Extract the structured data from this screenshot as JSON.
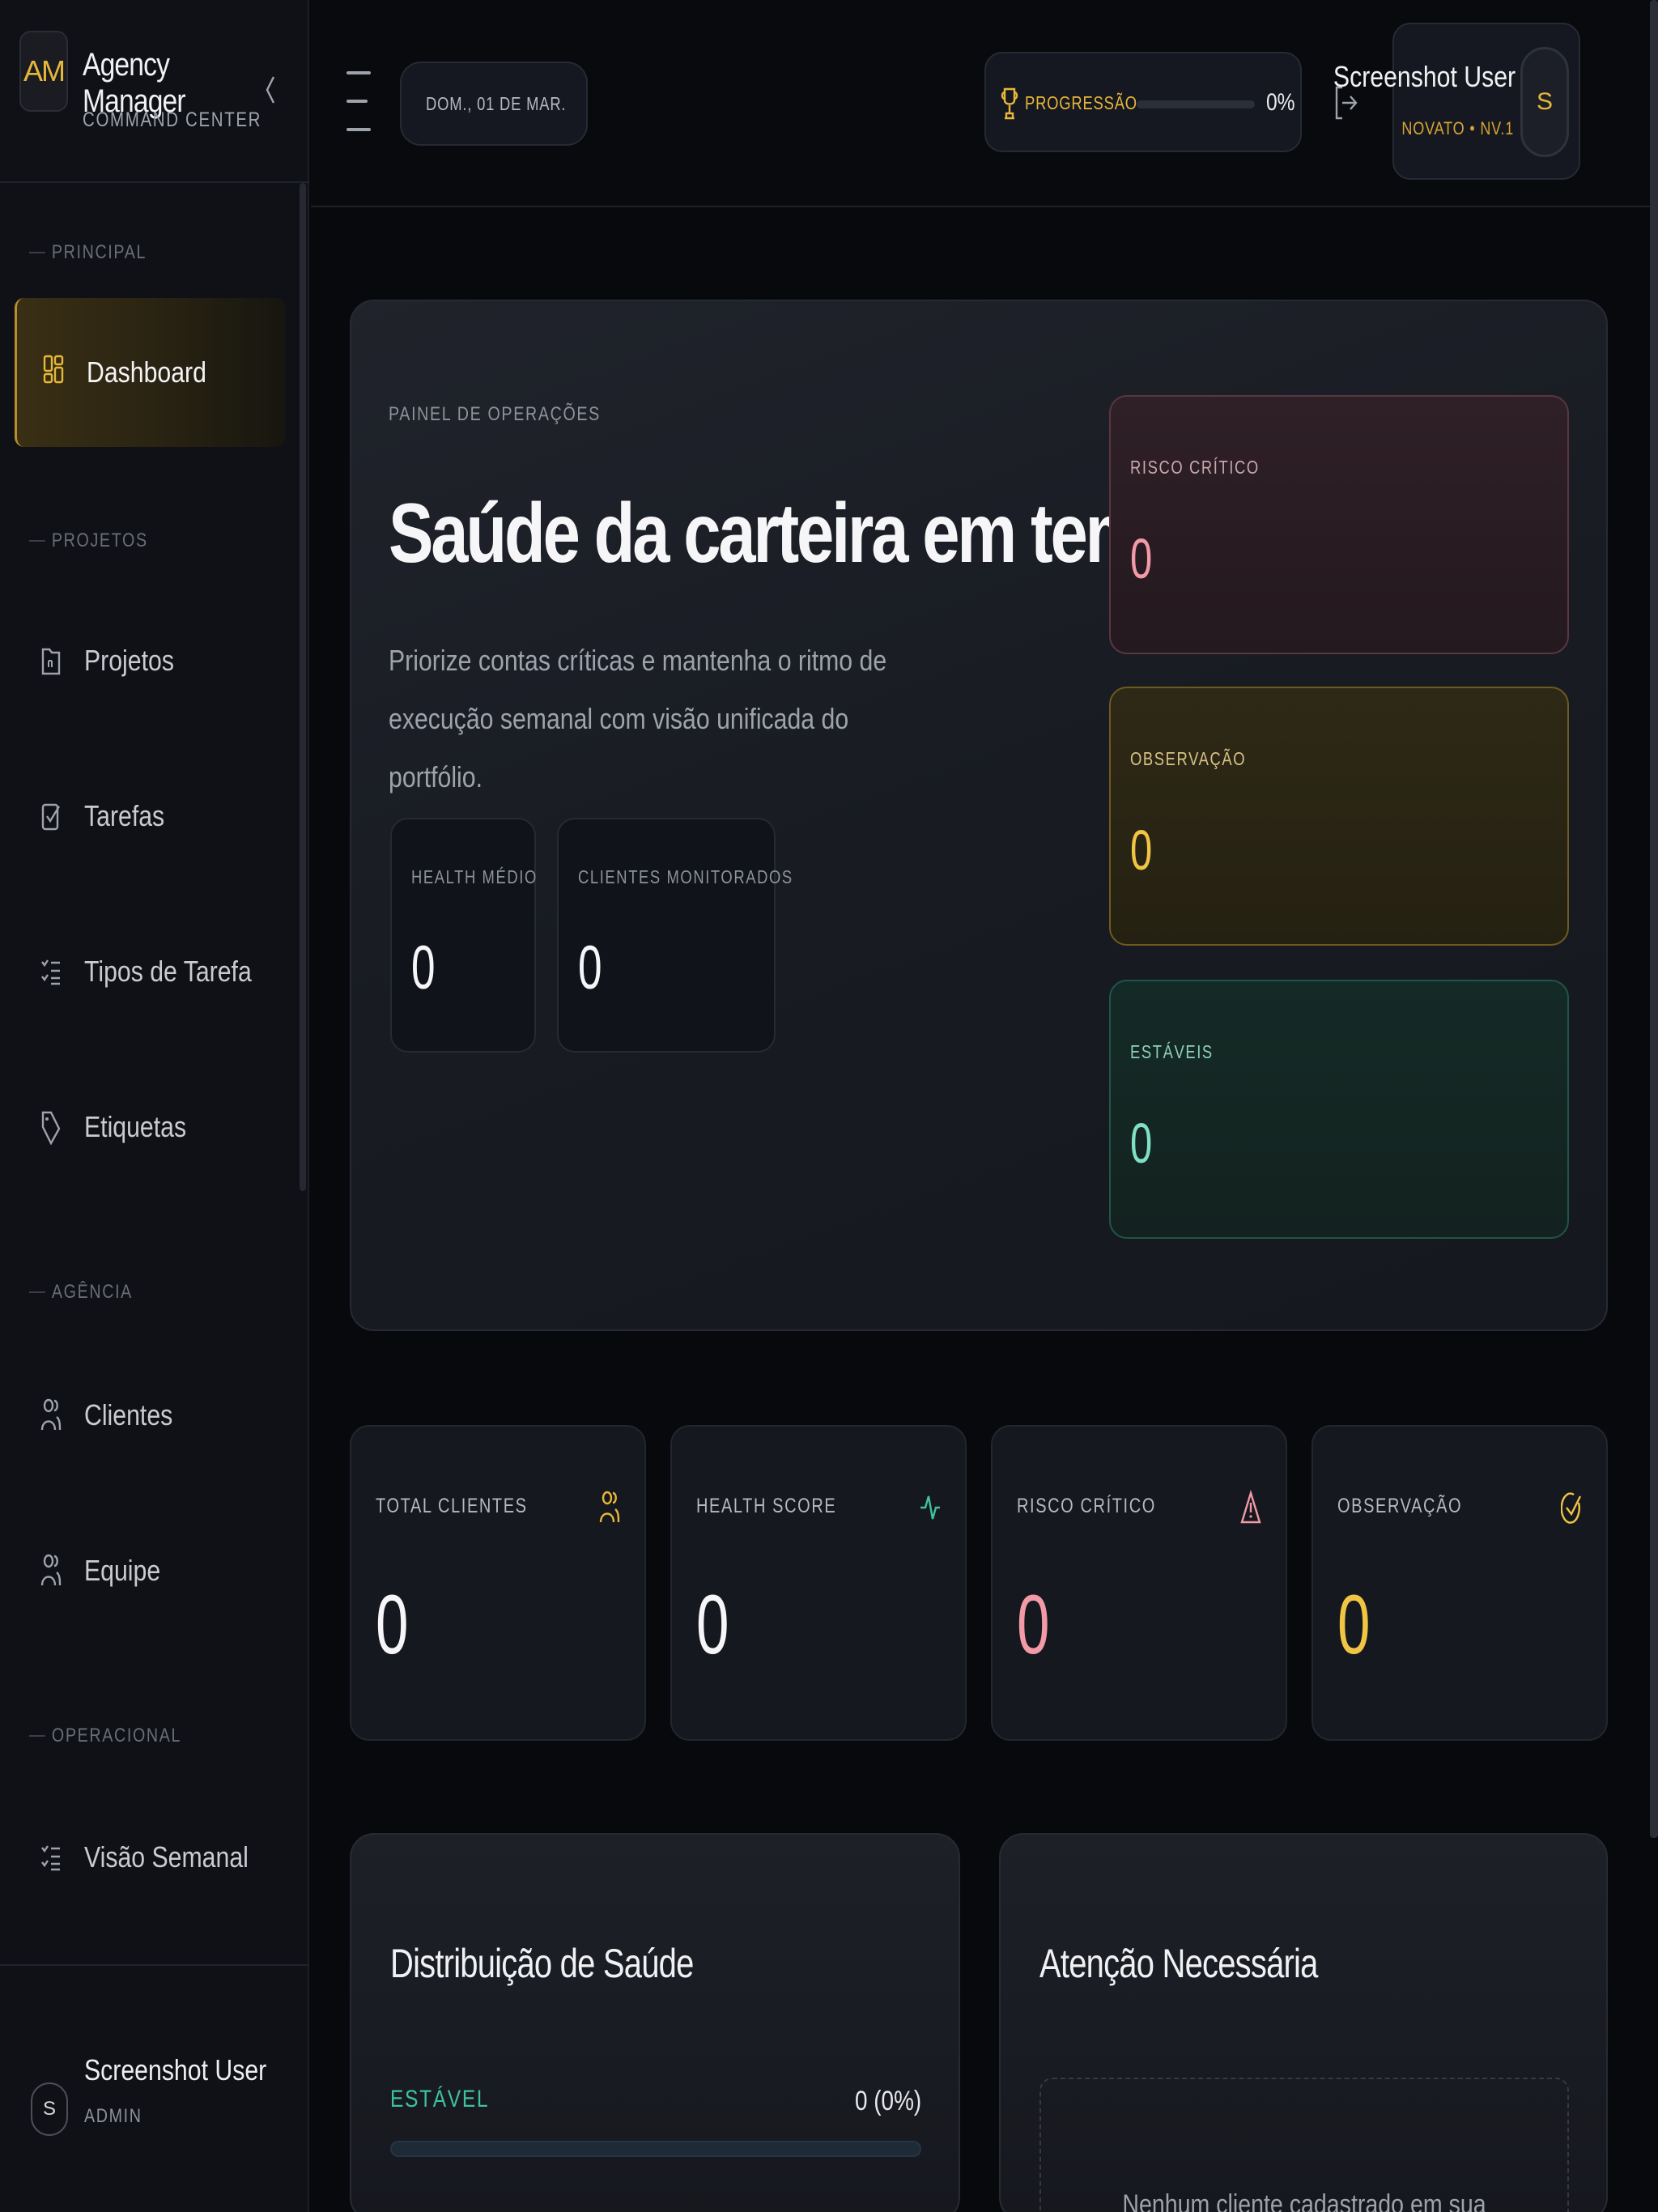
{
  "brand": {
    "logo": "AM",
    "title": "Agency Manager",
    "subtitle": "COMMAND CENTER"
  },
  "sidebar": {
    "sections": [
      "PRINCIPAL",
      "PROJETOS",
      "AGÊNCIA",
      "OPERACIONAL"
    ],
    "items": [
      {
        "label": "Dashboard",
        "icon": "dashboard-icon",
        "active": true
      },
      {
        "label": "Projetos",
        "icon": "folder-icon"
      },
      {
        "label": "Tarefas",
        "icon": "checkbox-icon"
      },
      {
        "label": "Tipos de Tarefa",
        "icon": "list-check-icon"
      },
      {
        "label": "Etiquetas",
        "icon": "tag-icon"
      },
      {
        "label": "Clientes",
        "icon": "users-icon"
      },
      {
        "label": "Equipe",
        "icon": "users-icon"
      },
      {
        "label": "Visão Semanal",
        "icon": "list-check-icon"
      }
    ],
    "footer": {
      "avatar": "S",
      "name": "Screenshot User",
      "role": "ADMIN"
    }
  },
  "topbar": {
    "date": "DOM., 01 DE MAR.",
    "progress": {
      "label": "PROGRESSÃO",
      "value": 0,
      "text": "0%"
    },
    "user": {
      "name": "Screenshot User",
      "level": "NOVATO • NV.1",
      "avatar": "S"
    }
  },
  "hero": {
    "eyebrow": "PAINEL DE OPERAÇÕES",
    "title": "Saúde da carteira em tempo real",
    "description": "Priorize contas críticas e mantenha o ritmo de execução semanal com visão unificada do portfólio.",
    "mini": [
      {
        "label": "HEALTH MÉDIO",
        "value": "0"
      },
      {
        "label": "CLIENTES MONITORADOS",
        "value": "0"
      }
    ],
    "status": [
      {
        "label": "RISCO CRÍTICO",
        "value": "0"
      },
      {
        "label": "OBSERVAÇÃO",
        "value": "0"
      },
      {
        "label": "ESTÁVEIS",
        "value": "0"
      }
    ]
  },
  "kpis": [
    {
      "label": "TOTAL CLIENTES",
      "value": "0",
      "icon": "users-icon",
      "color": "#e7b73a"
    },
    {
      "label": "HEALTH SCORE",
      "value": "0",
      "icon": "pulse-icon",
      "color": "#3fc19c"
    },
    {
      "label": "RISCO CRÍTICO",
      "value": "0",
      "icon": "warning-icon",
      "color": "#f29aa7"
    },
    {
      "label": "OBSERVAÇÃO",
      "value": "0",
      "icon": "check-circle-icon",
      "color": "#f1c544"
    }
  ],
  "distribution": {
    "title": "Distribuição de Saúde",
    "rows": [
      {
        "label": "ESTÁVEL",
        "value": "0 (0%)",
        "fraction": 0
      }
    ]
  },
  "attention": {
    "title": "Atenção Necessária",
    "empty": "Nenhum cliente cadastrado em sua agência"
  }
}
